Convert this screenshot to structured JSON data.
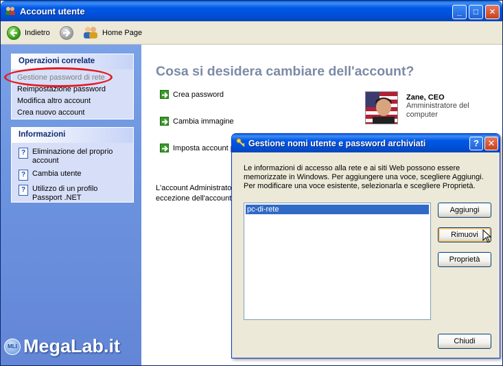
{
  "window": {
    "title": "Account utente",
    "controls": {
      "minimize": "_",
      "maximize": "□",
      "close": "✕"
    }
  },
  "toolbar": {
    "back_label": "Indietro",
    "home_label": "Home Page"
  },
  "related_tasks": {
    "header": "Operazioni correlate",
    "items": [
      "Gestione password di rete",
      "Reimpostazione password",
      "Modifica altro account",
      "Crea nuovo account"
    ]
  },
  "info": {
    "header": "Informazioni",
    "items": [
      "Eliminazione del proprio account",
      "Cambia utente",
      "Utilizzo di un profilo Passport .NET"
    ]
  },
  "main": {
    "heading": "Cosa si desidera cambiare dell'account?",
    "tasks": [
      "Crea password",
      "Cambia immagine",
      "Imposta account p"
    ],
    "note_line1": "L'account Administrator",
    "note_line2": "eccezione dell'account G"
  },
  "user": {
    "name": "Zane, CEO",
    "role": "Amministratore del computer"
  },
  "dialog": {
    "title": "Gestione nomi utente e password archiviati",
    "help": "?",
    "close": "✕",
    "description": "Le informazioni di accesso alla rete e ai siti Web possono essere memorizzate in Windows. Per aggiungere una voce, scegliere Aggiungi. Per modificare una voce esistente, selezionarla e scegliere Proprietà.",
    "list_items": [
      "pc-di-rete"
    ],
    "buttons": {
      "add": "Aggiungi",
      "remove": "Rimuovi",
      "properties": "Proprietà",
      "close": "Chiudi"
    }
  },
  "watermark": {
    "text": "MegaLab.it",
    "badge": "MLI"
  },
  "colors": {
    "accent": "#0058e6",
    "highlight": "#e31b23",
    "selection": "#316ac5"
  }
}
